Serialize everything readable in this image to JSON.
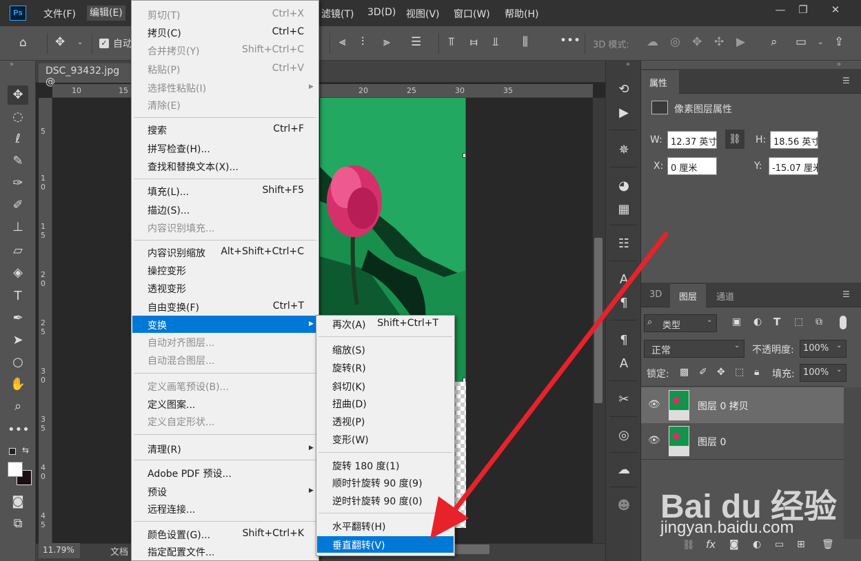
{
  "menubar": {
    "logo": "Ps",
    "items": [
      "文件(F)",
      "编辑(E)",
      "滤镜(T)",
      "3D(D)",
      "视图(V)",
      "窗口(W)",
      "帮助(H)"
    ]
  },
  "window": {
    "minimize": "—",
    "restore": "❐",
    "close": "✕"
  },
  "options": {
    "auto_label": "自动",
    "mode_3d": "3D 模式:"
  },
  "document": {
    "tab": "DSC_93432.jpg @",
    "ruler_top": [
      "10",
      "15",
      "20",
      "25",
      "30",
      "35"
    ],
    "ruler_left": [
      "5",
      "1 0",
      "1 5",
      "2 0",
      "2 5",
      "3 0",
      "3 5",
      "4 0",
      "4 5"
    ],
    "zoom": "11.79%",
    "status": "文档"
  },
  "edit_menu": {
    "items": [
      {
        "label": "剪切(T)",
        "shortcut": "Ctrl+X",
        "disabled": true
      },
      {
        "label": "拷贝(C)",
        "shortcut": "Ctrl+C",
        "disabled": false
      },
      {
        "label": "合并拷贝(Y)",
        "shortcut": "Shift+Ctrl+C",
        "disabled": true
      },
      {
        "label": "粘贴(P)",
        "shortcut": "Ctrl+V",
        "disabled": true
      },
      {
        "label": "选择性粘贴(I)",
        "shortcut": "",
        "disabled": true
      },
      {
        "label": "清除(E)",
        "shortcut": "",
        "disabled": true
      },
      {
        "label": "搜索",
        "shortcut": "Ctrl+F",
        "disabled": false
      },
      {
        "label": "拼写检查(H)...",
        "shortcut": "",
        "disabled": false
      },
      {
        "label": "查找和替换文本(X)...",
        "shortcut": "",
        "disabled": false
      },
      {
        "label": "填充(L)...",
        "shortcut": "Shift+F5",
        "disabled": false
      },
      {
        "label": "描边(S)...",
        "shortcut": "",
        "disabled": false
      },
      {
        "label": "内容识别填充...",
        "shortcut": "",
        "disabled": true
      },
      {
        "label": "内容识别缩放",
        "shortcut": "Alt+Shift+Ctrl+C",
        "disabled": false
      },
      {
        "label": "操控变形",
        "shortcut": "",
        "disabled": false
      },
      {
        "label": "透视变形",
        "shortcut": "",
        "disabled": false
      },
      {
        "label": "自由变换(F)",
        "shortcut": "Ctrl+T",
        "disabled": false
      },
      {
        "label": "变换",
        "shortcut": "",
        "disabled": false
      },
      {
        "label": "自动对齐图层...",
        "shortcut": "",
        "disabled": true
      },
      {
        "label": "自动混合图层...",
        "shortcut": "",
        "disabled": true
      },
      {
        "label": "定义画笔预设(B)...",
        "shortcut": "",
        "disabled": true
      },
      {
        "label": "定义图案...",
        "shortcut": "",
        "disabled": false
      },
      {
        "label": "定义自定形状...",
        "shortcut": "",
        "disabled": true
      },
      {
        "label": "清理(R)",
        "shortcut": "",
        "disabled": false
      },
      {
        "label": "Adobe PDF 预设...",
        "shortcut": "",
        "disabled": false
      },
      {
        "label": "预设",
        "shortcut": "",
        "disabled": false
      },
      {
        "label": "远程连接...",
        "shortcut": "",
        "disabled": false
      },
      {
        "label": "颜色设置(G)...",
        "shortcut": "Shift+Ctrl+K",
        "disabled": false
      },
      {
        "label": "指定配置文件...",
        "shortcut": "",
        "disabled": false
      }
    ]
  },
  "transform_submenu": {
    "items": [
      {
        "label": "再次(A)",
        "shortcut": "Shift+Ctrl+T"
      },
      {
        "label": "缩放(S)",
        "shortcut": ""
      },
      {
        "label": "旋转(R)",
        "shortcut": ""
      },
      {
        "label": "斜切(K)",
        "shortcut": ""
      },
      {
        "label": "扭曲(D)",
        "shortcut": ""
      },
      {
        "label": "透视(P)",
        "shortcut": ""
      },
      {
        "label": "变形(W)",
        "shortcut": ""
      },
      {
        "label": "旋转 180 度(1)",
        "shortcut": ""
      },
      {
        "label": "顺时针旋转 90 度(9)",
        "shortcut": ""
      },
      {
        "label": "逆时针旋转 90 度(0)",
        "shortcut": ""
      },
      {
        "label": "水平翻转(H)",
        "shortcut": ""
      },
      {
        "label": "垂直翻转(V)",
        "shortcut": ""
      }
    ]
  },
  "properties": {
    "tab": "属性",
    "heading": "像素图层属性",
    "w_label": "W:",
    "w_value": "12.37 英寸",
    "h_label": "H:",
    "h_value": "18.56 英寸",
    "x_label": "X:",
    "x_value": "0 厘米",
    "y_label": "Y:",
    "y_value": "-15.07 厘米"
  },
  "layers": {
    "tabs": [
      "3D",
      "图层",
      "通道"
    ],
    "filter": "类型",
    "blend": "正常",
    "opacity_label": "不透明度:",
    "opacity": "100%",
    "lock_label": "锁定:",
    "fill_label": "填充:",
    "fill": "100%",
    "rows": [
      {
        "name": "图层 0 拷贝"
      },
      {
        "name": "图层 0"
      }
    ]
  },
  "watermark": {
    "logo": "Bai du 经验",
    "url": "jingyan.baidu.com"
  },
  "colors": {
    "highlight": "#0078d7",
    "arrow": "#e8222a"
  }
}
